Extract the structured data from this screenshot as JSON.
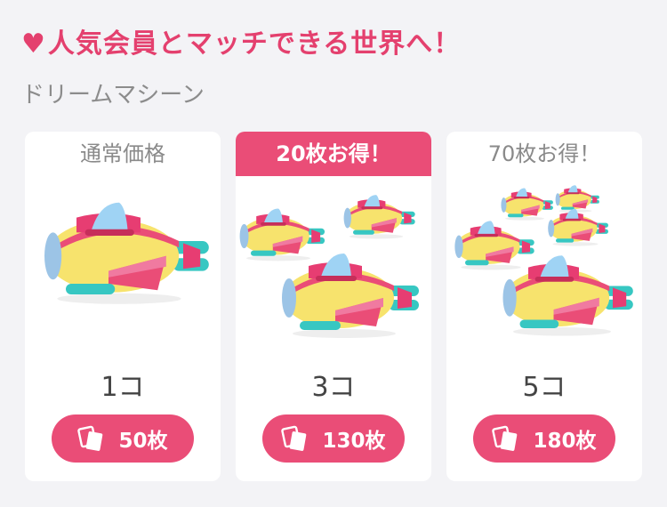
{
  "header": {
    "heart_icon": "heart-icon",
    "title": "人気会員とマッチできる世界へ！",
    "subtitle": "ドリームマシーン"
  },
  "colors": {
    "accent": "#ea4d77",
    "background": "#f3f3f6"
  },
  "plans": [
    {
      "label": "通常価格",
      "featured": false,
      "quantity_label": "1コ",
      "price_label": "50枚",
      "icon": "coin-icon"
    },
    {
      "label": "20枚お得！",
      "featured": true,
      "quantity_label": "3コ",
      "price_label": "130枚",
      "icon": "coin-icon"
    },
    {
      "label": "70枚お得！",
      "featured": false,
      "quantity_label": "5コ",
      "price_label": "180枚",
      "icon": "coin-icon"
    }
  ]
}
